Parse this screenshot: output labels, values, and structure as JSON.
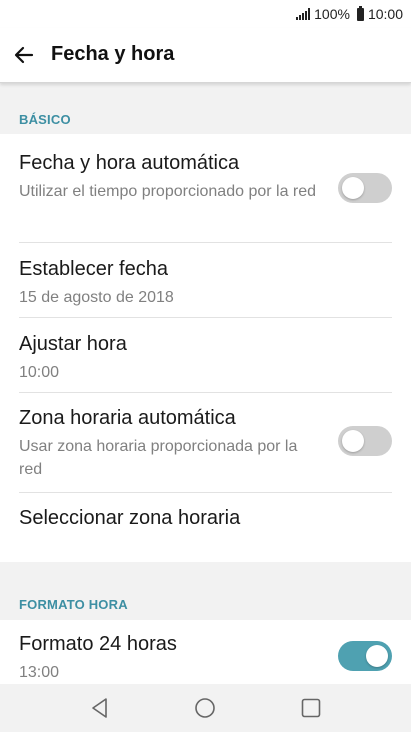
{
  "status_bar": {
    "battery": "100%",
    "time": "10:00"
  },
  "header": {
    "title": "Fecha y hora"
  },
  "sections": [
    {
      "label": "BÁSICO",
      "items": [
        {
          "title": "Fecha y hora automática",
          "subtitle": "Utilizar el tiempo proporcionado por la red",
          "toggle": false
        },
        {
          "title": "Establecer fecha",
          "subtitle": "15 de agosto de 2018"
        },
        {
          "title": "Ajustar hora",
          "subtitle": "10:00"
        },
        {
          "title": "Zona horaria automática",
          "subtitle": "Usar zona horaria proporcionada por la red",
          "toggle": false
        },
        {
          "title": "Seleccionar zona horaria"
        }
      ]
    },
    {
      "label": "FORMATO HORA",
      "items": [
        {
          "title": "Formato 24 horas",
          "subtitle": "13:00",
          "toggle": true
        }
      ]
    }
  ],
  "nav": {
    "back": "triangle-back-icon",
    "home": "circle-home-icon",
    "recents": "square-recents-icon"
  },
  "colors": {
    "accent": "#3d8fa3",
    "toggle_on": "#4fa1b1",
    "toggle_off": "#cfcfcf"
  }
}
